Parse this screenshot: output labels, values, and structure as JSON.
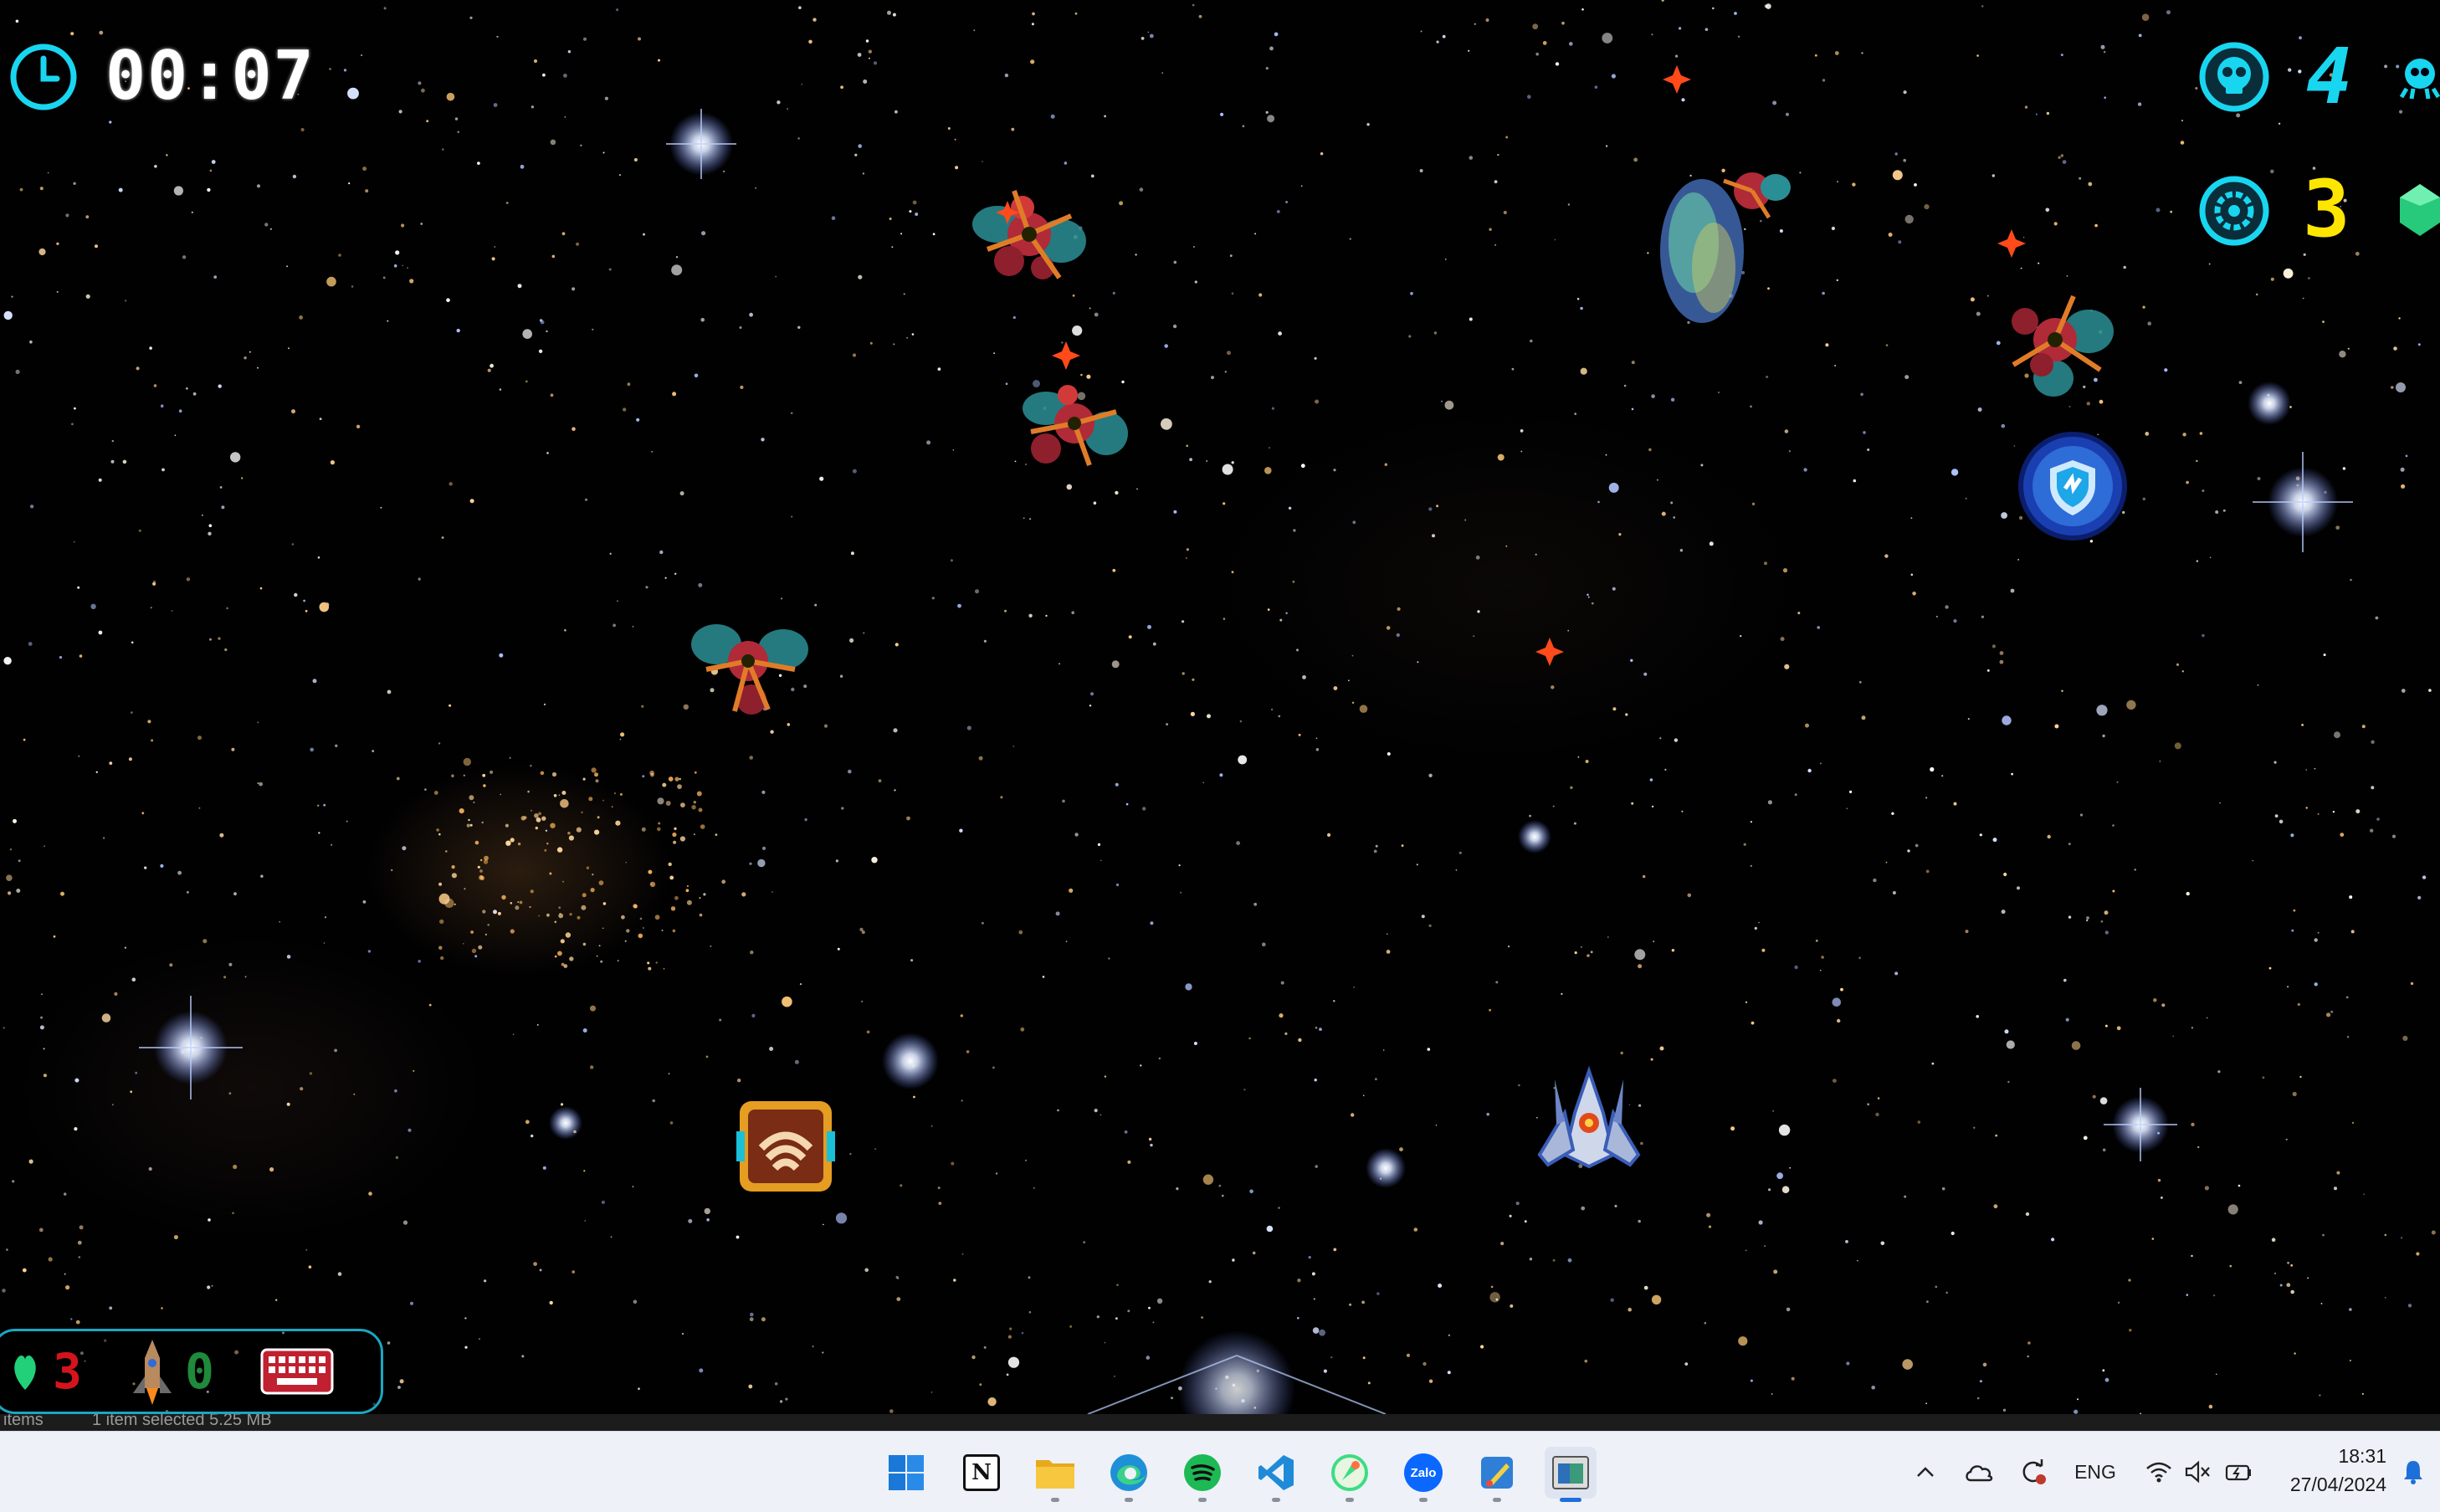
{
  "hud": {
    "timer": "00:07",
    "kills": "4",
    "gems": "3",
    "lives": "3",
    "missiles": "0"
  },
  "explorer_status": {
    "items": "items",
    "selection": "1 item selected  5.25 MB"
  },
  "taskbar": {
    "apps": [
      "start",
      "notion",
      "file-explorer",
      "edge",
      "spotify",
      "vscode",
      "android-studio",
      "zalo",
      "paint",
      "game"
    ],
    "zalo_label": "Zalo",
    "notion_label": "N",
    "language": "ENG",
    "time": "18:31",
    "date": "27/04/2024"
  },
  "colors": {
    "hud_cyan": "#19d6f0",
    "gem_yellow": "#ffe600",
    "lives_red": "#d4141c",
    "missile_green": "#1f8a3a",
    "inventory_border": "#1aa7c2"
  }
}
